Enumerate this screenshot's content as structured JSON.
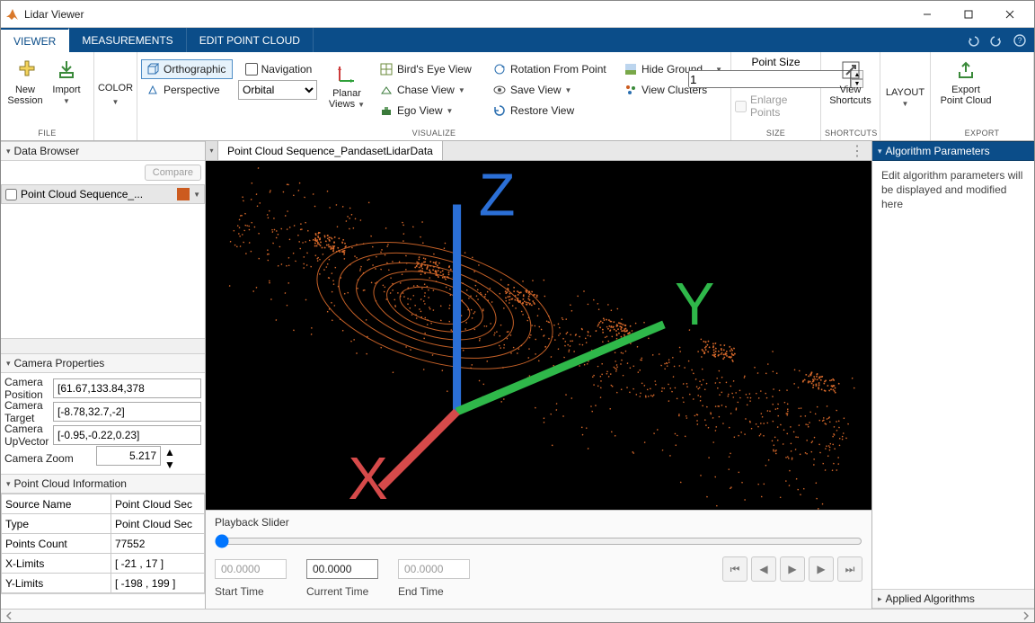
{
  "window": {
    "title": "Lidar Viewer"
  },
  "tabs": {
    "viewer": "VIEWER",
    "measurements": "MEASUREMENTS",
    "editpc": "EDIT POINT CLOUD"
  },
  "ribbon": {
    "file": {
      "label": "FILE",
      "new_session": "New\nSession",
      "import": "Import"
    },
    "color": {
      "label": "COLOR"
    },
    "visualize": {
      "label": "VISUALIZE",
      "orthographic": "Orthographic",
      "perspective": "Perspective",
      "navigation": "Navigation",
      "orbital": "Orbital",
      "planar_views": "Planar\nViews",
      "birds_eye": "Bird's Eye View",
      "chase": "Chase View",
      "ego": "Ego View",
      "rotation_from_point": "Rotation From Point",
      "save_view": "Save View",
      "restore_view": "Restore View",
      "hide_ground": "Hide Ground",
      "view_clusters": "View Clusters"
    },
    "size": {
      "label": "SIZE",
      "point_size": "Point Size",
      "value": "1",
      "enlarge": "Enlarge Points"
    },
    "shortcuts": {
      "label": "SHORTCUTS",
      "view_shortcuts": "View\nShortcuts"
    },
    "layout": {
      "label": "LAYOUT"
    },
    "export": {
      "label": "EXPORT",
      "export_pc": "Export\nPoint Cloud"
    }
  },
  "data_browser": {
    "title": "Data Browser",
    "compare": "Compare",
    "item_name": "Point Cloud Sequence_..."
  },
  "camera_props": {
    "title": "Camera Properties",
    "position_label": "Camera Position",
    "position_value": "[61.67,133.84,378",
    "target_label": "Camera Target",
    "target_value": "[-8.78,32.7,-2]",
    "up_label": "Camera UpVector",
    "up_value": "[-0.95,-0.22,0.23]",
    "zoom_label": "Camera Zoom",
    "zoom_value": "5.217"
  },
  "pc_info": {
    "title": "Point Cloud Information",
    "rows": [
      [
        "Source Name",
        "Point Cloud Sec"
      ],
      [
        "Type",
        "Point Cloud Sec"
      ],
      [
        "Points Count",
        "77552"
      ],
      [
        "X-Limits",
        "[ -21 , 17 ]"
      ],
      [
        "Y-Limits",
        "[ -198 , 199 ]"
      ]
    ]
  },
  "document": {
    "tab": "Point Cloud Sequence_PandasetLidarData",
    "axes": {
      "x": "X",
      "y": "Y",
      "z": "Z"
    }
  },
  "playback": {
    "title": "Playback Slider",
    "start": "00.0000",
    "current": "00.0000",
    "end": "00.0000",
    "start_label": "Start Time",
    "current_label": "Current Time",
    "end_label": "End Time"
  },
  "right": {
    "algo_params_title": "Algorithm Parameters",
    "algo_params_text": "Edit algorithm parameters will be displayed and modified here",
    "applied_title": "Applied Algorithms"
  }
}
